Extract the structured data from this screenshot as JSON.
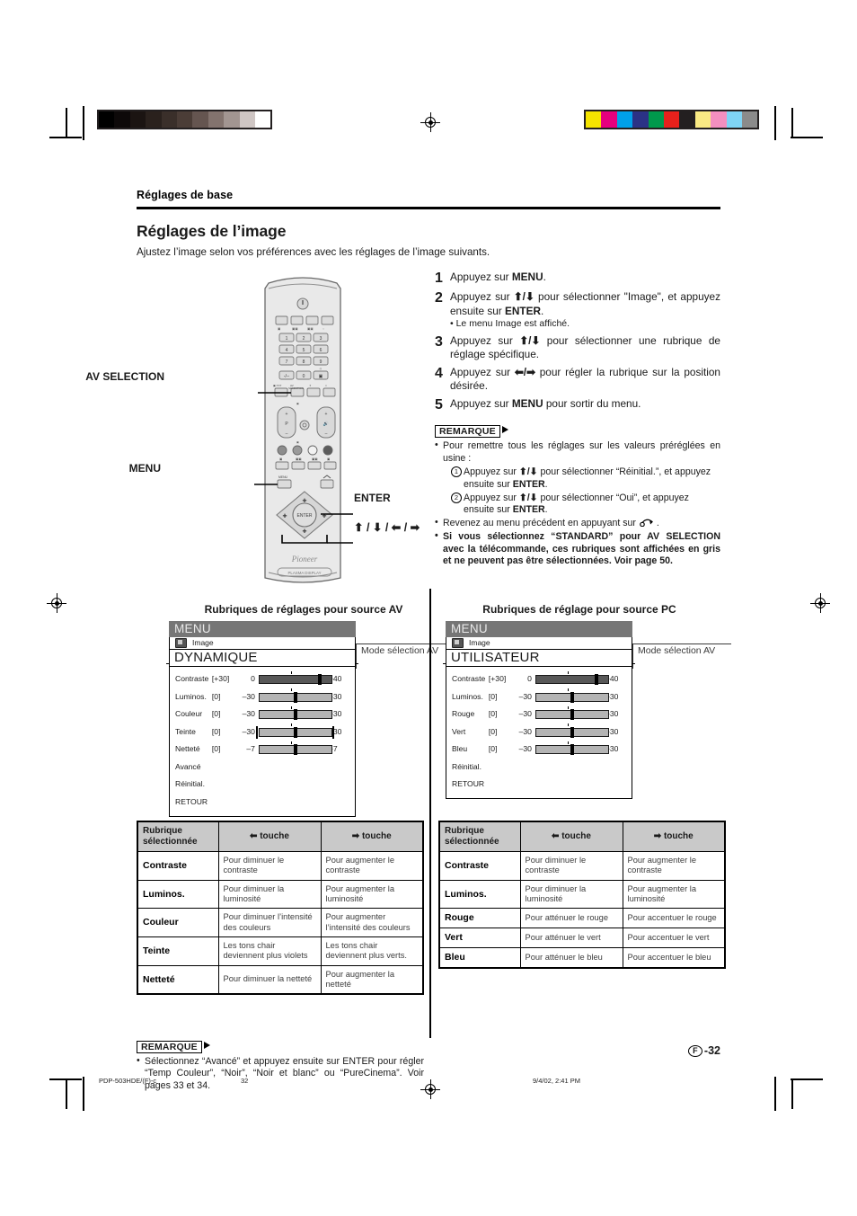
{
  "document": {
    "running_head": "Réglages de base",
    "section_title": "Réglages de l’image",
    "intro": "Ajustez l’image selon vos préférences avec les réglages de l’image suivants.",
    "page_number": "-32",
    "page_marker": "F"
  },
  "footer": {
    "file": "PDP-503HDE/(F)-c",
    "page": "32",
    "timestamp": "9/4/02, 2:41 PM"
  },
  "remote": {
    "labels": {
      "av_selection": "AV SELECTION",
      "menu": "MENU",
      "enter": "ENTER",
      "cursor": "⬆ / ⬇ / ⬅ / ➡"
    },
    "brand": "Pioneer",
    "badge": "PLASMA DISPLAY"
  },
  "steps": [
    {
      "num": "1",
      "html": "Appuyez sur <b>MENU</b>."
    },
    {
      "num": "2",
      "html": "Appuyez sur <b>⬆/⬇</b> pour sélectionner \"Image\", et appuyez ensuite sur <b>ENTER</b>.",
      "sub": "• Le menu Image est affiché."
    },
    {
      "num": "3",
      "html": "Appuyez sur <b>⬆/⬇</b> pour sélectionner une rubrique de réglage spécifique."
    },
    {
      "num": "4",
      "html": "Appuyez sur <b>⬅/➡</b> pour régler la rubrique sur la position désirée."
    },
    {
      "num": "5",
      "html": "Appuyez sur <b>MENU</b> pour sortir du menu."
    }
  ],
  "note_top": {
    "tag": "REMARQUE",
    "items": [
      {
        "html": "Pour remettre tous les réglages sur les valeurs préréglées en usine :",
        "bold": false
      },
      {
        "html": "Revenez au menu précédent en appuyant sur",
        "bold": false,
        "icon": "return-arrow-icon"
      },
      {
        "html": "Si vous sélectionnez “STANDARD” pour AV SELECTION avec la télécommande, ces rubriques sont affichées en gris et ne peuvent pas être sélectionnées. Voir page 50.",
        "bold": true
      }
    ],
    "sub_items": [
      {
        "num": "1",
        "html": "Appuyez sur <b>⬆/⬇</b> pour sélectionner “Réinitial.”, et appuyez ensuite sur <b>ENTER</b>."
      },
      {
        "num": "2",
        "html": "Appuyez sur <b>⬆/⬇</b> pour sélectionner “Oui”, et appuyez ensuite sur <b>ENTER</b>."
      }
    ]
  },
  "note_bottom": {
    "tag": "REMARQUE",
    "text": "Sélectionnez “Avancé” et appuyez ensuite sur  ENTER pour régler “Temp Couleur”, “Noir”, “Noir et blanc” ou “PureCinema”. Voir pages 33 et 34."
  },
  "osd_av": {
    "caption": "Rubriques de réglages pour source AV",
    "menu_title": "MENU",
    "tab_label": "Image",
    "mode_label": "DYNAMIQUE",
    "callout": "Mode sélection AV",
    "rows": [
      {
        "label": "Contraste",
        "bracket": "[+30]",
        "min": "0",
        "max": "+40",
        "bar": "dark",
        "knob": 83,
        "caps": false
      },
      {
        "label": "Luminos.",
        "bracket": "[0]",
        "min": "–30",
        "max": "+30",
        "bar": "light",
        "knob": 50,
        "caps": false
      },
      {
        "label": "Couleur",
        "bracket": "[0]",
        "min": "–30",
        "max": "+30",
        "bar": "light",
        "knob": 50,
        "caps": false
      },
      {
        "label": "Teinte",
        "bracket": "[0]",
        "min": "–30",
        "max": "+30",
        "bar": "light",
        "knob": 50,
        "caps": true
      },
      {
        "label": "Netteté",
        "bracket": "[0]",
        "min": "–7",
        "max": "+7",
        "bar": "light",
        "knob": 50,
        "caps": false
      }
    ],
    "plain_rows": [
      "Avancé",
      "Réinitial.",
      "RETOUR"
    ]
  },
  "osd_pc": {
    "caption": "Rubriques de réglage pour source PC",
    "menu_title": "MENU",
    "tab_label": "Image",
    "mode_label": "UTILISATEUR",
    "callout": "Mode sélection AV",
    "rows": [
      {
        "label": "Contraste",
        "bracket": "[+30]",
        "min": "0",
        "max": "+40",
        "bar": "dark",
        "knob": 83,
        "caps": false
      },
      {
        "label": "Luminos.",
        "bracket": "[0]",
        "min": "–30",
        "max": "+30",
        "bar": "light",
        "knob": 50,
        "caps": false
      },
      {
        "label": "Rouge",
        "bracket": "[0]",
        "min": "–30",
        "max": "+30",
        "bar": "light",
        "knob": 50,
        "caps": false
      },
      {
        "label": "Vert",
        "bracket": "[0]",
        "min": "–30",
        "max": "+30",
        "bar": "light",
        "knob": 50,
        "caps": false
      },
      {
        "label": "Bleu",
        "bracket": "[0]",
        "min": "–30",
        "max": "+30",
        "bar": "light",
        "knob": 50,
        "caps": false
      }
    ],
    "plain_rows": [
      "Réinitial.",
      "RETOUR"
    ]
  },
  "table_av": {
    "headers": [
      "Rubrique sélectionnée",
      "⬅ touche",
      "➡ touche"
    ],
    "rows": [
      {
        "item": "Contraste",
        "left": "Pour diminuer le contraste",
        "right": "Pour augmenter le contraste"
      },
      {
        "item": "Luminos.",
        "left": "Pour diminuer la luminosité",
        "right": "Pour augmenter la luminosité"
      },
      {
        "item": "Couleur",
        "left": "Pour diminuer l’intensité des couleurs",
        "right": "Pour augmenter l’intensité des couleurs"
      },
      {
        "item": "Teinte",
        "left": "Les tons chair deviennent plus violets",
        "right": "Les tons chair deviennent plus verts."
      },
      {
        "item": "Netteté",
        "left": "Pour diminuer la netteté",
        "right": "Pour augmenter la netteté"
      }
    ]
  },
  "table_pc": {
    "headers": [
      "Rubrique sélectionnée",
      "⬅ touche",
      "➡ touche"
    ],
    "rows": [
      {
        "item": "Contraste",
        "left": "Pour diminuer le contraste",
        "right": "Pour augmenter le contraste"
      },
      {
        "item": "Luminos.",
        "left": "Pour diminuer la luminosité",
        "right": "Pour augmenter la luminosité"
      },
      {
        "item": "Rouge",
        "left": "Pour atténuer le rouge",
        "right": "Pour accentuer le rouge"
      },
      {
        "item": "Vert",
        "left": "Pour atténuer le vert",
        "right": "Pour accentuer le vert"
      },
      {
        "item": "Bleu",
        "left": "Pour atténuer le bleu",
        "right": "Pour accentuer le bleu"
      }
    ]
  },
  "print_marks": {
    "grayscale_bar": [
      "#000000",
      "#0d0909",
      "#1b1412",
      "#2a211d",
      "#3a2f2a",
      "#4b3d37",
      "#655550",
      "#83736e",
      "#a29591",
      "#cfc6c4",
      "#ffffff"
    ],
    "color_bar": [
      "#f5e400",
      "#e6007e",
      "#00a0e9",
      "#2b3286",
      "#00994c",
      "#e8211c",
      "#231f20",
      "#faea84",
      "#f48fc0",
      "#7fd4f5",
      "#8b8b8b"
    ]
  }
}
